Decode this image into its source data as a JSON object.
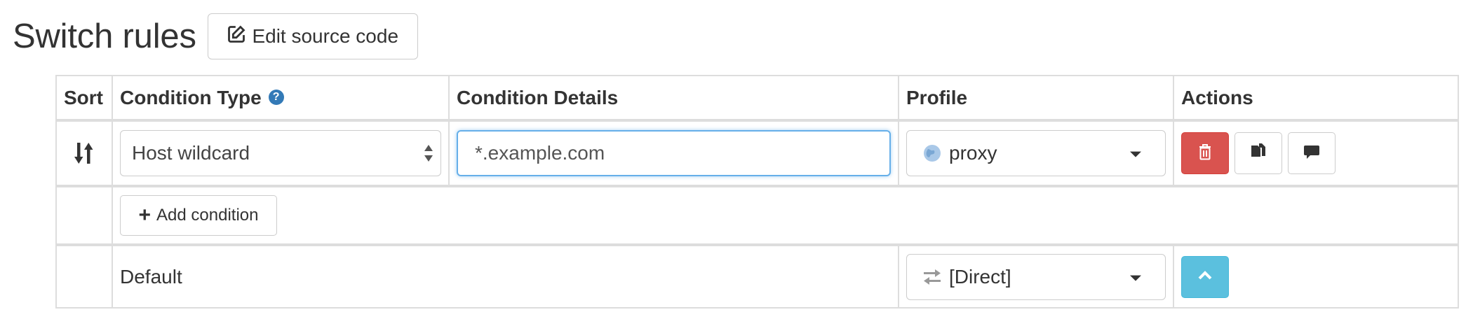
{
  "header": {
    "title": "Switch rules",
    "edit_button_label": "Edit source code",
    "edit_icon": "edit-square-icon"
  },
  "table": {
    "columns": {
      "sort": "Sort",
      "condition_type": "Condition Type",
      "condition_details": "Condition Details",
      "profile": "Profile",
      "actions": "Actions"
    },
    "help_icon_text": "?",
    "rules": [
      {
        "condition_type": "Host wildcard",
        "condition_details": "*.example.com",
        "profile": "proxy",
        "profile_icon": "globe-icon"
      }
    ],
    "add_condition_label": "Add condition",
    "default_row": {
      "label": "Default",
      "profile": "[Direct]",
      "profile_icon": "transfer-arrows-icon"
    }
  },
  "colors": {
    "danger": "#d9534f",
    "info": "#5bc0de",
    "help": "#337ab7",
    "focus_border": "#66afe9"
  }
}
